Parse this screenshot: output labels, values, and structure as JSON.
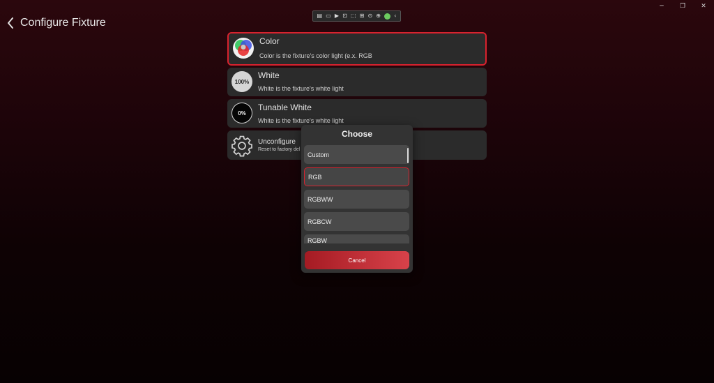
{
  "window": {
    "minimize_icon": "─",
    "restore_icon": "❐",
    "close_icon": "✕"
  },
  "debug_toolbar": {
    "items": [
      "▤",
      "▭",
      "▶",
      "⊡",
      "⬚",
      "⊞",
      "⊙",
      "⊕",
      "✓",
      "‹"
    ]
  },
  "header": {
    "title": "Configure Fixture",
    "back_icon": "chevron-left-icon"
  },
  "options": [
    {
      "title": "Color",
      "description": "Color is the fixture's color light (e.x. RGB",
      "icon": "rgb-color-wheel-icon",
      "selected": true
    },
    {
      "title": "White",
      "description": "White is the fixture's white light",
      "icon_text": "100%"
    },
    {
      "title": "Tunable White",
      "description": "White is the fixture's white light",
      "icon_text": "0%"
    },
    {
      "title": "Unconfigure",
      "description": "Reset to factory del",
      "icon": "gear-icon"
    }
  ],
  "dialog": {
    "title": "Choose",
    "choices": [
      "Custom",
      "RGB",
      "RGBWW",
      "RGBCW",
      "RGBW"
    ],
    "selected": "RGB",
    "cancel_label": "Cancel"
  },
  "colors": {
    "accent_red": "#d9222e",
    "card_bg": "#2b2b2b",
    "dialog_bg": "#333333"
  }
}
